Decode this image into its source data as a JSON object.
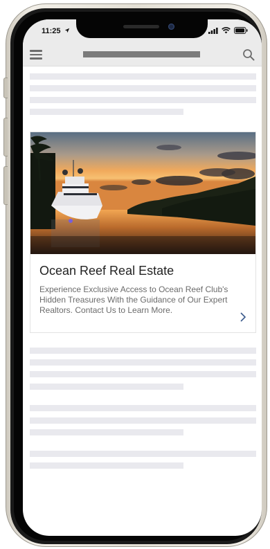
{
  "status_bar": {
    "time": "11:25"
  },
  "header": {
    "menu_icon": "hamburger-menu-icon",
    "search_icon": "search-icon"
  },
  "card": {
    "title": "Ocean Reef Real Estate",
    "description": " Experience Exclusive Access to Ocean Reef Club's Hidden Treasures With the Guidance of Our Expert Realtors. Contact Us to Learn More.",
    "link_icon": "chevron-right-icon",
    "image_icon": "yacht-sunset-photo"
  },
  "colors": {
    "header_bg": "#ebebeb",
    "title_placeholder": "#7b7b7b",
    "skeleton": "#e9e9ee",
    "chevron": "#3b5a8c"
  }
}
